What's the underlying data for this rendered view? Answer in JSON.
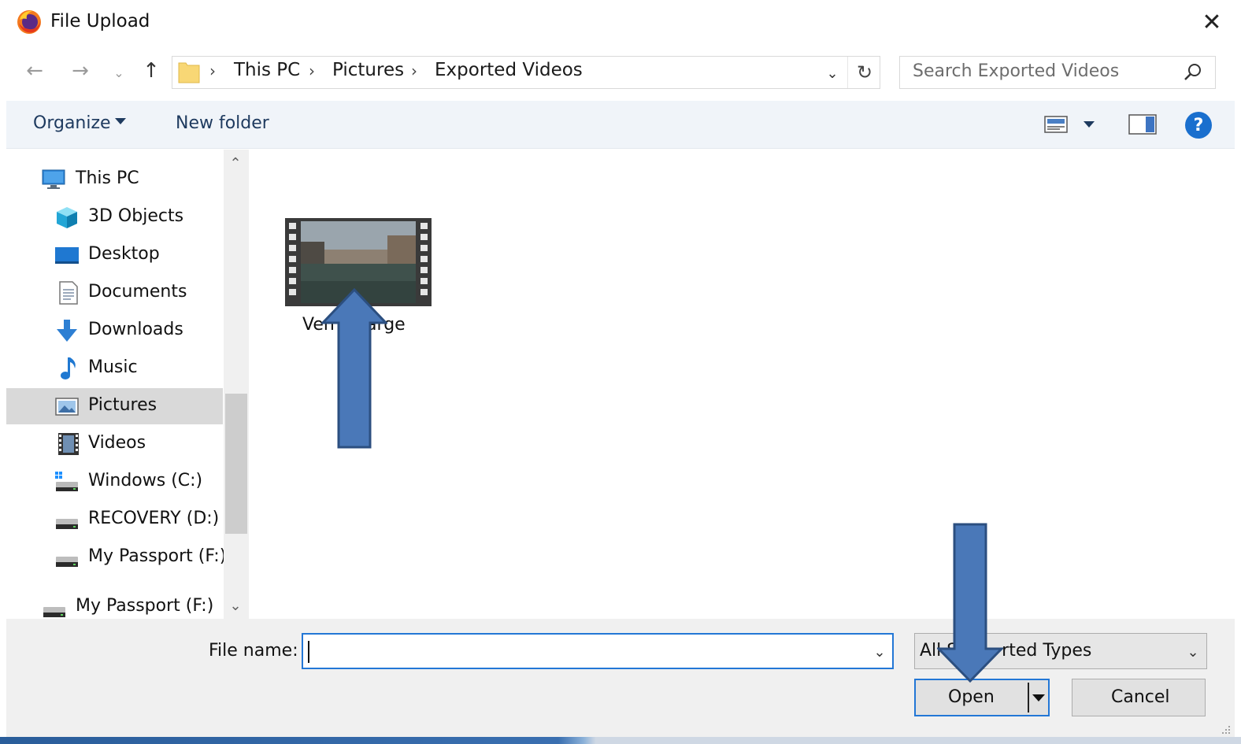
{
  "window": {
    "title": "File Upload",
    "close_label": "✕",
    "app_icon": "firefox-icon"
  },
  "address": {
    "crumbs": [
      "This PC",
      "Pictures",
      "Exported Videos"
    ],
    "separator": "›"
  },
  "search": {
    "placeholder": "Search Exported Videos"
  },
  "toolbar": {
    "organize_label": "Organize",
    "new_folder_label": "New folder",
    "help_label": "?"
  },
  "nav_pane": {
    "items": [
      {
        "label": "This PC",
        "icon": "computer-icon"
      },
      {
        "label": "3D Objects",
        "icon": "cube-icon"
      },
      {
        "label": "Desktop",
        "icon": "desktop-icon"
      },
      {
        "label": "Documents",
        "icon": "document-icon"
      },
      {
        "label": "Downloads",
        "icon": "download-arrow-icon"
      },
      {
        "label": "Music",
        "icon": "music-note-icon"
      },
      {
        "label": "Pictures",
        "icon": "picture-icon",
        "selected": true
      },
      {
        "label": "Videos",
        "icon": "film-icon"
      },
      {
        "label": "Windows (C:)",
        "icon": "windows-drive-icon"
      },
      {
        "label": "RECOVERY (D:)",
        "icon": "drive-icon"
      },
      {
        "label": "My Passport (F:)",
        "icon": "drive-icon"
      },
      {
        "label": "My Passport (F:)",
        "icon": "drive-icon"
      }
    ]
  },
  "content": {
    "file_label": "Ven    Large"
  },
  "bottom": {
    "filename_label": "File name:",
    "filename_value": "",
    "filetype_value": "All S        rted Types",
    "open_label": "Open",
    "cancel_label": "Cancel"
  },
  "colors": {
    "accent": "#2377d6",
    "annotation_arrow": "#4a78b8",
    "annotation_arrow_border": "#2c4f80",
    "selected_bg": "#d9d9d9",
    "toolbar_bg": "#f0f4f9"
  }
}
